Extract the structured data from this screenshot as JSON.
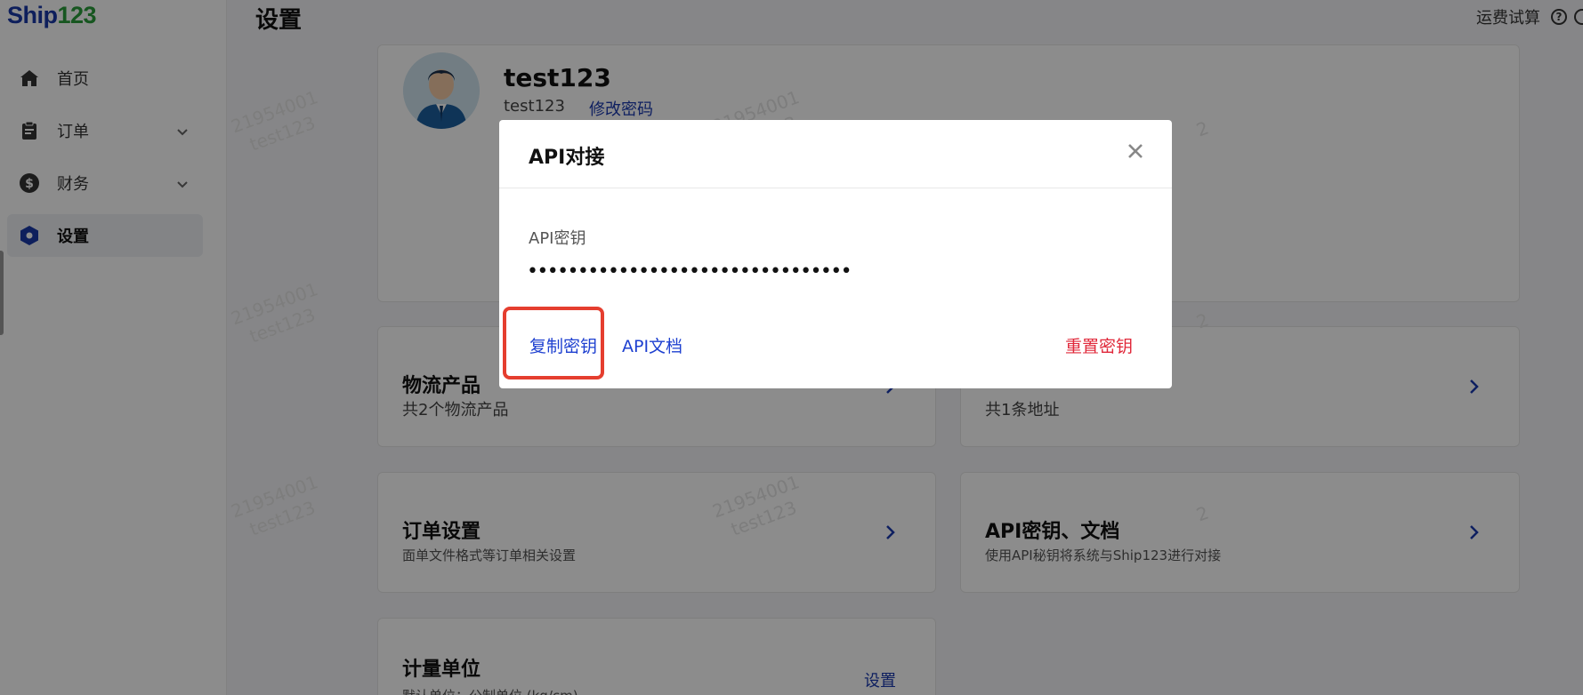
{
  "brand": {
    "part1": "Ship",
    "part2": "123",
    "color_primary": "#1a3aa8",
    "color_accent": "#2a9d3b"
  },
  "sidebar": {
    "items": [
      {
        "label": "首页",
        "icon": "home-icon"
      },
      {
        "label": "订单",
        "icon": "clipboard-icon"
      },
      {
        "label": "财务",
        "icon": "dollar-circle-icon"
      },
      {
        "label": "设置",
        "icon": "hexagon-settings-icon"
      }
    ]
  },
  "header": {
    "title": "设置",
    "freight_calc": "运费试算"
  },
  "profile": {
    "name": "test123",
    "username": "test123",
    "change_password": "修改密码"
  },
  "cards": {
    "logistics": {
      "title": "物流产品",
      "desc": "共2个物流产品"
    },
    "address": {
      "desc": "共1条地址"
    },
    "order": {
      "title": "订单设置",
      "desc": "面单文件格式等订单相关设置"
    },
    "api": {
      "title": "API密钥、文档",
      "desc": "使用API秘钥将系统与Ship123进行对接"
    },
    "unit": {
      "title": "计量单位",
      "desc": "默认单位：公制单位 (kg/cm)",
      "action": "设置"
    }
  },
  "watermark": {
    "id": "21954001",
    "user": "test123",
    "digit": "2"
  },
  "modal": {
    "title": "API对接",
    "key_label": "API密钥",
    "key_value": "••••••••••••••••••••••••••••••••",
    "copy_key": "复制密钥",
    "api_docs": "API文档",
    "reset_key": "重置密钥",
    "link_color": "#1e40d0",
    "danger_color": "#e0283a"
  }
}
